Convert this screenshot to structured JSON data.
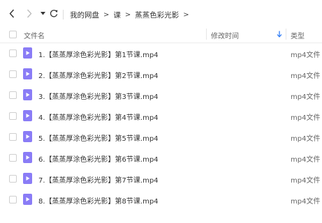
{
  "toolbar": {
    "back_icon": "chevron-left-icon",
    "forward_icon": "chevron-right-icon",
    "history_icon": "caret-down-icon",
    "refresh_icon": "refresh-icon"
  },
  "breadcrumb": {
    "items": [
      "我的网盘",
      "课",
      "蒸蒸色彩光影"
    ],
    "separator": ">"
  },
  "table": {
    "headers": {
      "name": "文件名",
      "modified": "修改时间",
      "type": "类型"
    },
    "sort_icon": "arrow-down-icon",
    "accent": "#2f7cf6",
    "file_icon_color": "#8a7cf6",
    "rows": [
      {
        "name": "1.【蒸蒸厚涂色彩光影】第1节课.mp4",
        "type": "mp4文件"
      },
      {
        "name": "2.【蒸蒸厚涂色彩光影】第2节课.mp4",
        "type": "mp4文件"
      },
      {
        "name": "3.【蒸蒸厚涂色彩光影】第3节课.mp4",
        "type": "mp4文件"
      },
      {
        "name": "4.【蒸蒸厚涂色彩光影】第4节课.mp4",
        "type": "mp4文件"
      },
      {
        "name": "5.【蒸蒸厚涂色彩光影】第5节课.mp4",
        "type": "mp4文件"
      },
      {
        "name": "6.【蒸蒸厚涂色彩光影】第6节课.mp4",
        "type": "mp4文件"
      },
      {
        "name": "7.【蒸蒸厚涂色彩光影】第7节课.mp4",
        "type": "mp4文件"
      },
      {
        "name": "8.【蒸蒸厚涂色彩光影】第8节课.mp4",
        "type": "mp4文件"
      }
    ]
  }
}
